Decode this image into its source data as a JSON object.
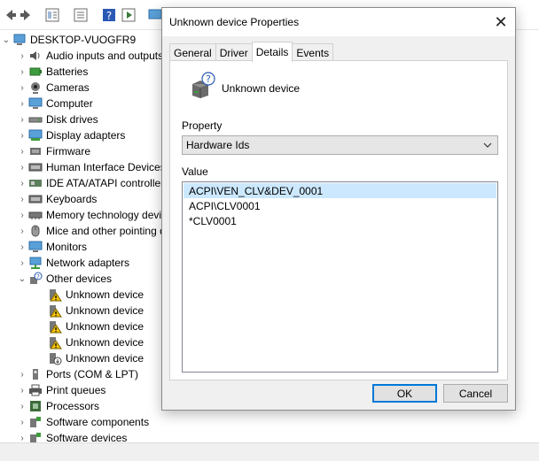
{
  "tree": {
    "root": "DESKTOP-VUOGFR9",
    "items": [
      {
        "label": "Audio inputs and outputs",
        "icon": "speaker-icon"
      },
      {
        "label": "Batteries",
        "icon": "battery-icon"
      },
      {
        "label": "Cameras",
        "icon": "camera-icon"
      },
      {
        "label": "Computer",
        "icon": "monitor-icon"
      },
      {
        "label": "Disk drives",
        "icon": "disk-icon"
      },
      {
        "label": "Display adapters",
        "icon": "display-icon"
      },
      {
        "label": "Firmware",
        "icon": "chip-icon"
      },
      {
        "label": "Human Interface Devices",
        "icon": "keyboard-icon"
      },
      {
        "label": "IDE ATA/ATAPI controllers",
        "icon": "controller-icon"
      },
      {
        "label": "Keyboards",
        "icon": "keyboard-icon"
      },
      {
        "label": "Memory technology devices",
        "icon": "memory-icon"
      },
      {
        "label": "Mice and other pointing devices",
        "icon": "mouse-icon"
      },
      {
        "label": "Monitors",
        "icon": "monitor-icon"
      },
      {
        "label": "Network adapters",
        "icon": "network-icon"
      }
    ],
    "other": {
      "label": "Other devices",
      "children": [
        "Unknown device",
        "Unknown device",
        "Unknown device",
        "Unknown device",
        "Unknown device"
      ]
    },
    "after": [
      {
        "label": "Ports (COM & LPT)",
        "icon": "port-icon"
      },
      {
        "label": "Print queues",
        "icon": "printer-icon"
      },
      {
        "label": "Processors",
        "icon": "processor-icon"
      },
      {
        "label": "Software components",
        "icon": "component-icon"
      },
      {
        "label": "Software devices",
        "icon": "component-icon"
      }
    ]
  },
  "dialog": {
    "title": "Unknown device Properties",
    "tabs": [
      "General",
      "Driver",
      "Details",
      "Events"
    ],
    "active_tab": "Details",
    "device_name": "Unknown device",
    "property_label": "Property",
    "property_value": "Hardware Ids",
    "value_label": "Value",
    "values": [
      "ACPI\\VEN_CLV&DEV_0001",
      "ACPI\\CLV0001",
      "*CLV0001"
    ],
    "ok_label": "OK",
    "cancel_label": "Cancel"
  },
  "colors": {
    "accent": "#0078d7",
    "selection": "#cce8ff",
    "dialog_bg": "#f0f0f0"
  }
}
